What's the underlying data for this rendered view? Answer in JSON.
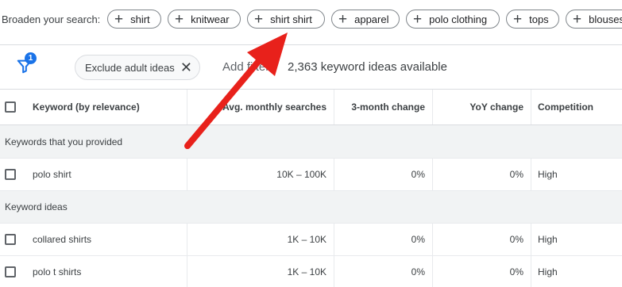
{
  "broaden": {
    "label": "Broaden your search:",
    "chips": [
      "shirt",
      "knitwear",
      "shirt shirt",
      "apparel",
      "polo clothing",
      "tops",
      "blouses"
    ]
  },
  "filters": {
    "badge_count": "1",
    "exclude_chip": "Exclude adult ideas",
    "add_filter": "Add filter",
    "idea_count": "2,363 keyword ideas available"
  },
  "table": {
    "columns": [
      "Keyword (by relevance)",
      "Avg. monthly searches",
      "3-month change",
      "YoY change",
      "Competition"
    ],
    "section_provided": "Keywords that you provided",
    "provided_rows": [
      {
        "keyword": "polo shirt",
        "searches": "10K – 100K",
        "three_month": "0%",
        "yoy": "0%",
        "competition": "High"
      }
    ],
    "section_ideas": "Keyword ideas",
    "idea_rows": [
      {
        "keyword": "collared shirts",
        "searches": "1K – 10K",
        "three_month": "0%",
        "yoy": "0%",
        "competition": "High"
      },
      {
        "keyword": "polo t shirts",
        "searches": "1K – 10K",
        "three_month": "0%",
        "yoy": "0%",
        "competition": "High"
      }
    ]
  },
  "colors": {
    "accent": "#1a73e8",
    "annotation_arrow": "#e8211b",
    "section_bg": "#f1f3f4"
  },
  "icons": {
    "filter": "filter-funnel-icon",
    "chip_add": "plus-icon",
    "chip_remove": "close-icon"
  }
}
